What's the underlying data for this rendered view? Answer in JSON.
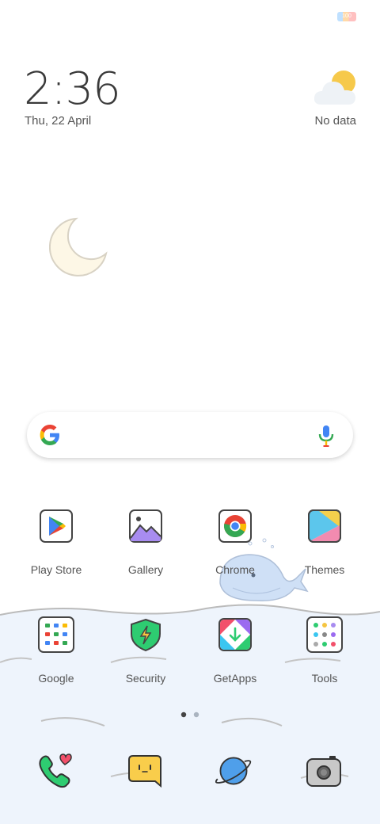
{
  "status_bar": {
    "battery_label": "100"
  },
  "clock": {
    "time": "2:36",
    "date": "Thu, 22 April"
  },
  "weather": {
    "text": "No data",
    "icon": "partly-cloudy-icon"
  },
  "search": {
    "logo": "google-g-icon",
    "voice": "mic-icon"
  },
  "apps": [
    {
      "label": "Play Store",
      "icon": "play-store-icon"
    },
    {
      "label": "Gallery",
      "icon": "gallery-icon"
    },
    {
      "label": "Chrome",
      "icon": "chrome-icon"
    },
    {
      "label": "Themes",
      "icon": "themes-icon"
    },
    {
      "label": "Google",
      "icon": "google-folder-icon"
    },
    {
      "label": "Security",
      "icon": "security-icon"
    },
    {
      "label": "GetApps",
      "icon": "getapps-icon"
    },
    {
      "label": "Tools",
      "icon": "tools-folder-icon"
    }
  ],
  "page_indicator": {
    "current": 1,
    "total": 2
  },
  "dock": [
    {
      "icon": "phone-icon"
    },
    {
      "icon": "messages-icon"
    },
    {
      "icon": "browser-icon"
    },
    {
      "icon": "camera-icon"
    }
  ],
  "colors": {
    "sea": "#eef4fc",
    "wave": "#b8b8b8",
    "accent_green": "#2ecc71",
    "chrome_red": "#e84335"
  }
}
